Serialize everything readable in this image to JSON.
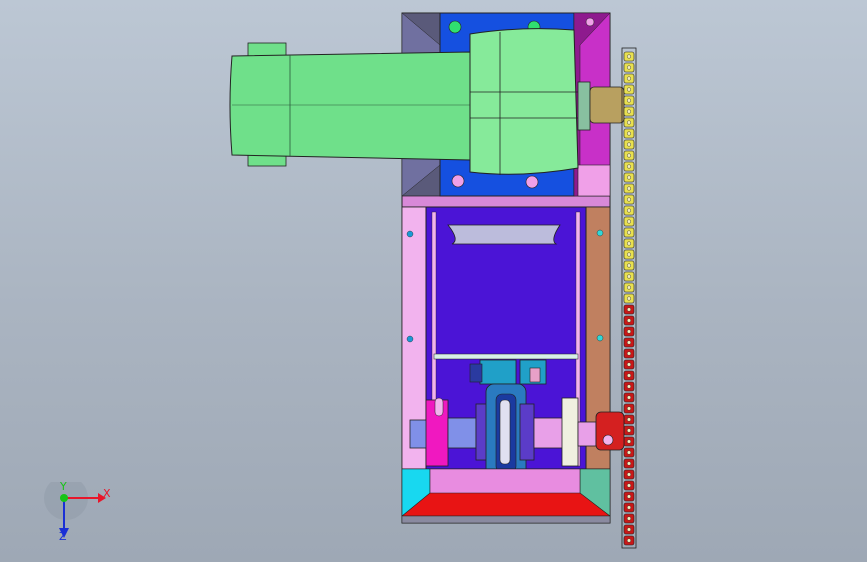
{
  "viewport": {
    "background_top": "#bcc7d4",
    "background_bottom": "#9ea8b5"
  },
  "triad": {
    "x_label": "X",
    "y_label": "Y",
    "z_label": "Z",
    "x_color": "#e8162a",
    "y_color": "#18c418",
    "z_color": "#1a2fd6"
  },
  "model": {
    "motor_color": "#6fe08a",
    "frame_top_color": "#1550e0",
    "inner_frame_color": "#4b14d6",
    "left_plate_color": "#f2b3ee",
    "right_plate_color": "#c08060",
    "bottom_plate_color": "#e81414",
    "chain_color": "#e8e050",
    "hub_color": "#d42020"
  }
}
